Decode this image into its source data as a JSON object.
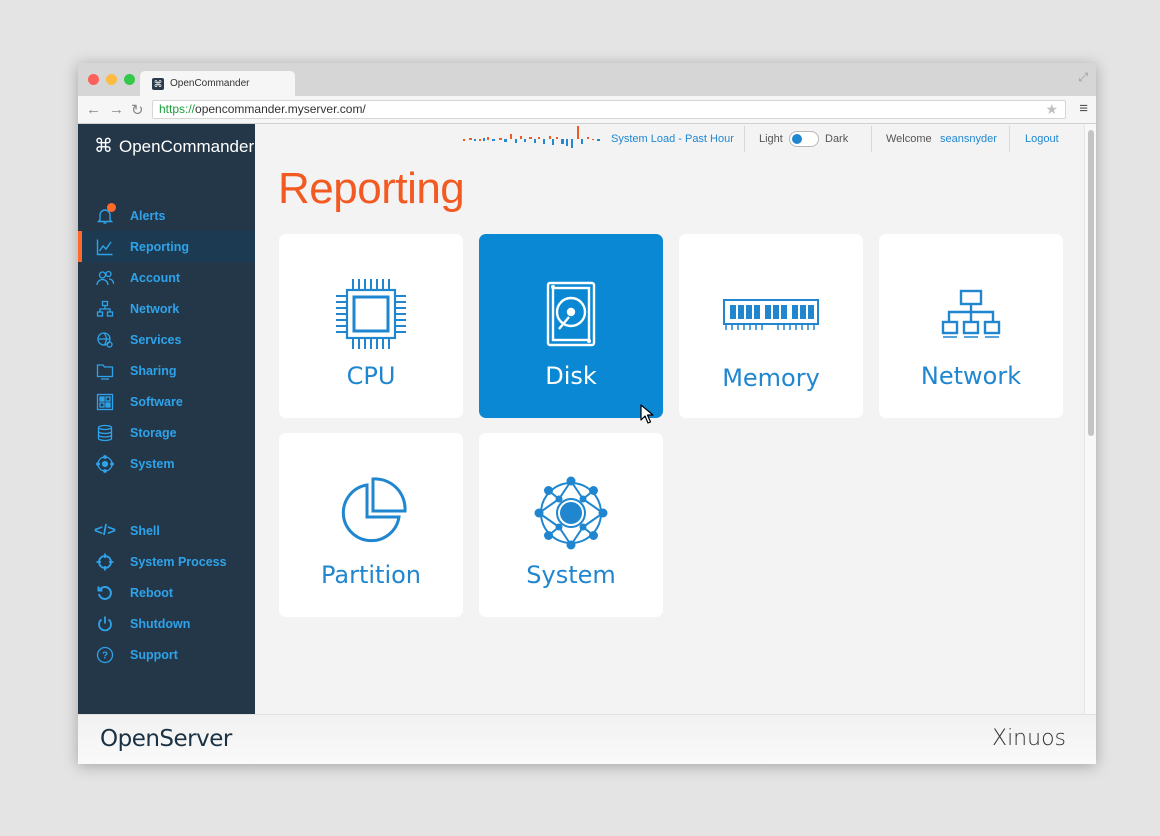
{
  "browser": {
    "tab_title": "OpenCommander",
    "favicon": "⌘",
    "url_scheme": "https://",
    "url_rest": "opencommander.myserver.com/"
  },
  "app": {
    "brand": "OpenCommander",
    "brand_icon": "command-icon"
  },
  "sidebar": {
    "items": [
      {
        "label": "Alerts",
        "icon": "bell-icon",
        "alert": true
      },
      {
        "label": "Reporting",
        "icon": "chart-icon",
        "active": true
      },
      {
        "label": "Account",
        "icon": "users-icon"
      },
      {
        "label": "Network",
        "icon": "network-icon"
      },
      {
        "label": "Services",
        "icon": "services-icon"
      },
      {
        "label": "Sharing",
        "icon": "folder-icon"
      },
      {
        "label": "Software",
        "icon": "grid-icon"
      },
      {
        "label": "Storage",
        "icon": "database-icon"
      },
      {
        "label": "System",
        "icon": "system-icon"
      }
    ],
    "tools": [
      {
        "label": "Shell",
        "icon": "code-icon"
      },
      {
        "label": "System Process",
        "icon": "crosshair-icon"
      },
      {
        "label": "Reboot",
        "icon": "reboot-icon"
      },
      {
        "label": "Shutdown",
        "icon": "power-icon"
      },
      {
        "label": "Support",
        "icon": "help-icon"
      }
    ]
  },
  "topbar": {
    "load_label": "System Load - Past Hour",
    "light_label": "Light",
    "dark_label": "Dark",
    "welcome_label": "Welcome",
    "username": "seansnyder",
    "logout_label": "Logout"
  },
  "page": {
    "title": "Reporting",
    "tiles": [
      {
        "label": "CPU",
        "icon": "cpu-icon"
      },
      {
        "label": "Disk",
        "icon": "disk-icon",
        "selected": true
      },
      {
        "label": "Memory",
        "icon": "memory-icon"
      },
      {
        "label": "Network",
        "icon": "network-icon"
      },
      {
        "label": "Partition",
        "icon": "pie-icon"
      },
      {
        "label": "System",
        "icon": "system-icon"
      }
    ]
  },
  "footer": {
    "left": "OpenServer",
    "right": "Xinuos"
  },
  "colors": {
    "accent_orange": "#f25a22",
    "accent_blue": "#0b88d4",
    "sidebar_bg": "#243749"
  }
}
